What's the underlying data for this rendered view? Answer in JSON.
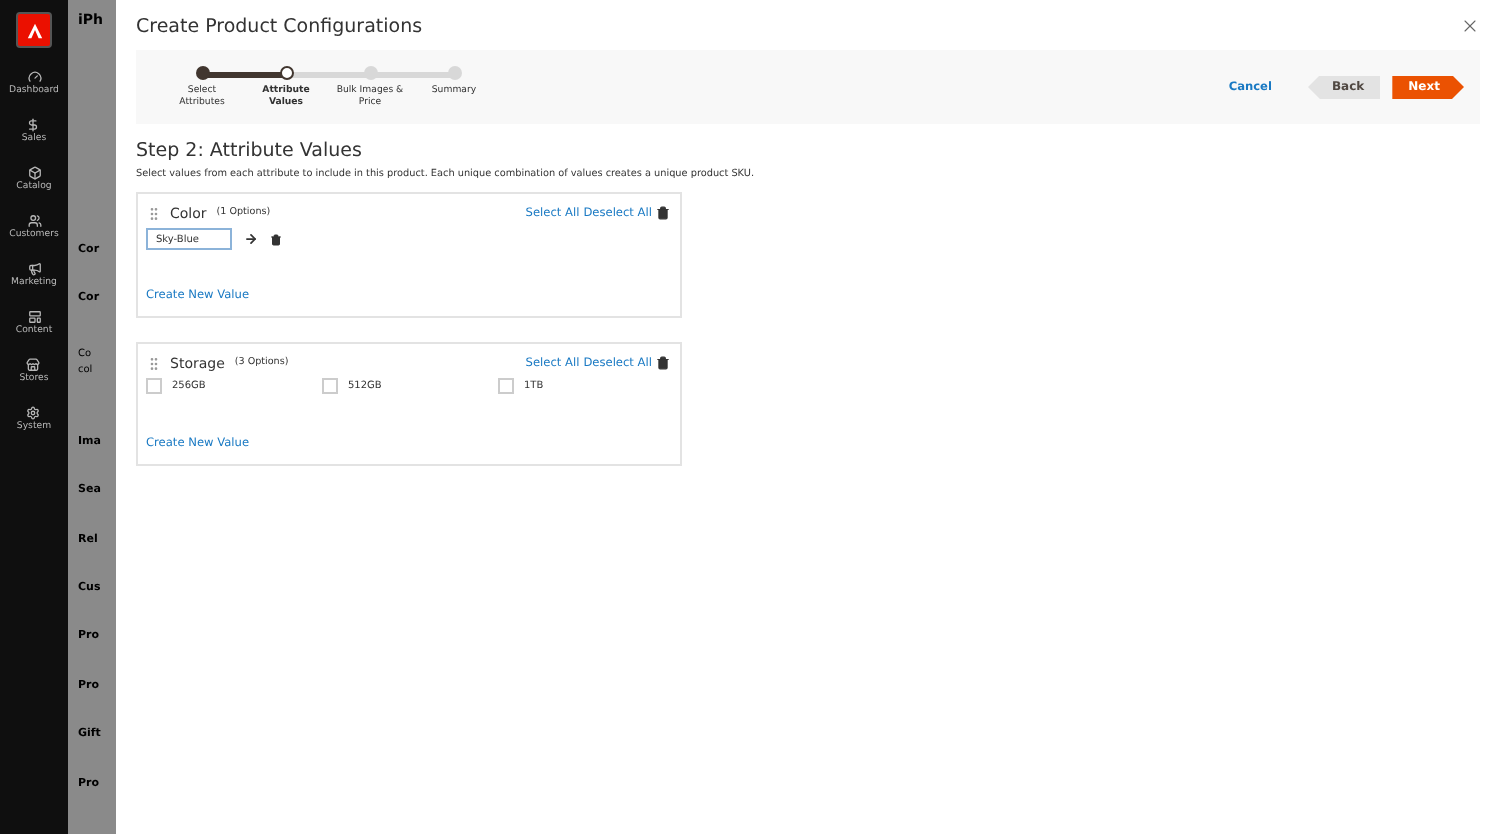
{
  "sidebar": {
    "items": [
      {
        "label": "Dashboard"
      },
      {
        "label": "Sales"
      },
      {
        "label": "Catalog"
      },
      {
        "label": "Customers"
      },
      {
        "label": "Marketing"
      },
      {
        "label": "Content"
      },
      {
        "label": "Stores"
      },
      {
        "label": "System"
      }
    ]
  },
  "background_page": {
    "title": "iPh",
    "sections": [
      {
        "kind": "heading",
        "text": "Cor"
      },
      {
        "kind": "heading",
        "text": "Cor"
      },
      {
        "kind": "note",
        "lines": [
          "Co",
          "col"
        ]
      },
      {
        "kind": "heading",
        "text": "Ima"
      },
      {
        "kind": "heading",
        "text": "Sea"
      },
      {
        "kind": "heading",
        "text": "Rel"
      },
      {
        "kind": "heading",
        "text": "Cus"
      },
      {
        "kind": "heading",
        "text": "Pro"
      },
      {
        "kind": "heading",
        "text": "Pro"
      },
      {
        "kind": "heading",
        "text": "Gift"
      },
      {
        "kind": "heading",
        "text": "Pro"
      }
    ]
  },
  "modal": {
    "title": "Create Product Configurations",
    "steps": [
      {
        "label": "Select Attributes",
        "kind": "done"
      },
      {
        "label": "Attribute Values",
        "kind": "current"
      },
      {
        "label": "Bulk Images & Price",
        "kind": "pending"
      },
      {
        "label": "Summary",
        "kind": "pending"
      }
    ],
    "actions": {
      "cancel": "Cancel",
      "back": "Back",
      "next": "Next"
    },
    "step_title": "Step 2: Attribute Values",
    "description": "Select values from each attribute to include in this product. Each unique combination of values creates a unique product SKU.",
    "attributes": [
      {
        "name": "Color",
        "count": "(1 Options)",
        "kind": "inputs",
        "select_all": "Select All",
        "deselect_all": "Deselect All",
        "values": [
          {
            "value": "Sky-Blue"
          }
        ],
        "create": "Create New Value"
      },
      {
        "name": "Storage",
        "count": "(3 Options)",
        "kind": "checkboxes",
        "select_all": "Select All",
        "deselect_all": "Deselect All",
        "values": [
          {
            "label": "256GB",
            "checked": false
          },
          {
            "label": "512GB",
            "checked": false
          },
          {
            "label": "1TB",
            "checked": false
          }
        ],
        "create": "Create New Value"
      }
    ]
  }
}
